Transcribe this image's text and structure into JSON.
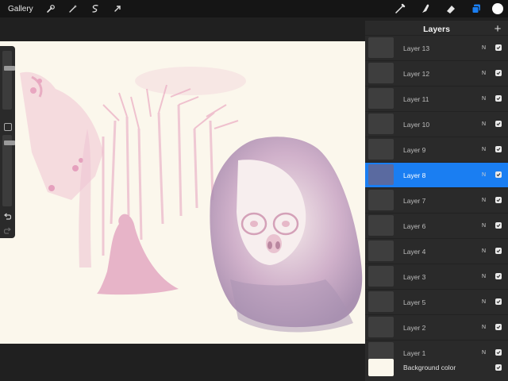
{
  "toolbar": {
    "gallery_label": "Gallery",
    "left_tools": [
      "wrench-icon",
      "magic-wand-icon",
      "selection-icon",
      "transform-arrow-icon"
    ],
    "right_tools": [
      "brush-icon",
      "smudge-icon",
      "eraser-icon",
      "layers-icon"
    ],
    "active_color": "#ffffff",
    "layers_active_color": "#1a7ef2"
  },
  "layers_panel": {
    "title": "Layers",
    "add_icon": "plus-icon",
    "layers": [
      {
        "name": "Layer 13",
        "mode": "N",
        "visible": true,
        "selected": false
      },
      {
        "name": "Layer 12",
        "mode": "N",
        "visible": true,
        "selected": false
      },
      {
        "name": "Layer 11",
        "mode": "N",
        "visible": true,
        "selected": false
      },
      {
        "name": "Layer 10",
        "mode": "N",
        "visible": true,
        "selected": false
      },
      {
        "name": "Layer 9",
        "mode": "N",
        "visible": true,
        "selected": false
      },
      {
        "name": "Layer 8",
        "mode": "N",
        "visible": true,
        "selected": true
      },
      {
        "name": "Layer 7",
        "mode": "N",
        "visible": true,
        "selected": false
      },
      {
        "name": "Layer 6",
        "mode": "N",
        "visible": true,
        "selected": false
      },
      {
        "name": "Layer 4",
        "mode": "N",
        "visible": true,
        "selected": false
      },
      {
        "name": "Layer 3",
        "mode": "N",
        "visible": true,
        "selected": false
      },
      {
        "name": "Layer 5",
        "mode": "N",
        "visible": true,
        "selected": false
      },
      {
        "name": "Layer 2",
        "mode": "N",
        "visible": true,
        "selected": false
      },
      {
        "name": "Layer 1",
        "mode": "N",
        "visible": true,
        "selected": false
      }
    ],
    "background": {
      "name": "Background color",
      "color": "#fbf7ec",
      "visible": true
    }
  },
  "sidebar": {
    "brush_size_level": 0.72,
    "opacity_level": 0.92,
    "icons": [
      "modify-square-icon",
      "undo-icon",
      "redo-icon"
    ]
  },
  "canvas": {
    "paper_color": "#fbf7ec",
    "ink_color": "#e8a6c0"
  }
}
